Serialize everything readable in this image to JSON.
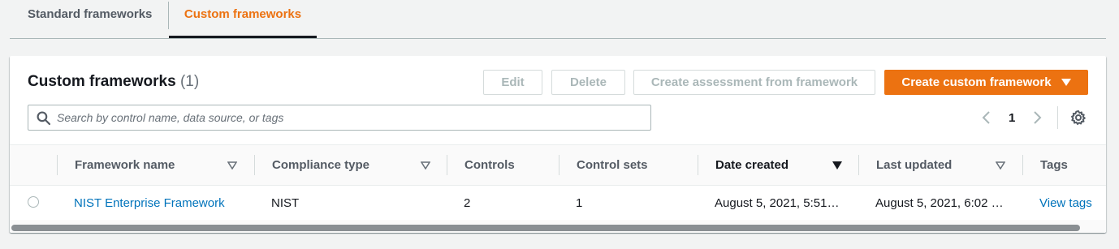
{
  "tabs": [
    {
      "label": "Standard frameworks",
      "active": false
    },
    {
      "label": "Custom frameworks",
      "active": true
    }
  ],
  "panel": {
    "title": "Custom frameworks",
    "count": "(1)",
    "buttons": {
      "edit": "Edit",
      "delete": "Delete",
      "create_assessment": "Create assessment from framework",
      "create_custom": "Create custom framework"
    },
    "search": {
      "placeholder": "Search by control name, data source, or tags",
      "value": ""
    },
    "pagination": {
      "current_page": "1"
    }
  },
  "table": {
    "columns": [
      {
        "label": "Framework name",
        "sort": "none"
      },
      {
        "label": "Compliance type",
        "sort": "none"
      },
      {
        "label": "Controls"
      },
      {
        "label": "Control sets"
      },
      {
        "label": "Date created",
        "sort": "descending"
      },
      {
        "label": "Last updated",
        "sort": "none"
      },
      {
        "label": "Tags"
      }
    ],
    "rows": [
      {
        "selected": false,
        "framework_name": "NIST Enterprise Framework",
        "compliance_type": "NIST",
        "controls": "2",
        "control_sets": "1",
        "date_created": "August 5, 2021, 5:51…",
        "last_updated": "August 5, 2021, 6:02 …",
        "tags": "View tags"
      }
    ]
  },
  "colors": {
    "accent": "#ec7211",
    "link": "#0073bb",
    "text": "#16191f",
    "muted": "#687078",
    "background": "#f2f3f3"
  },
  "icons": [
    "search-icon",
    "chevron-left-icon",
    "chevron-right-icon",
    "gear-icon",
    "caret-down-icon",
    "sort-icon"
  ]
}
